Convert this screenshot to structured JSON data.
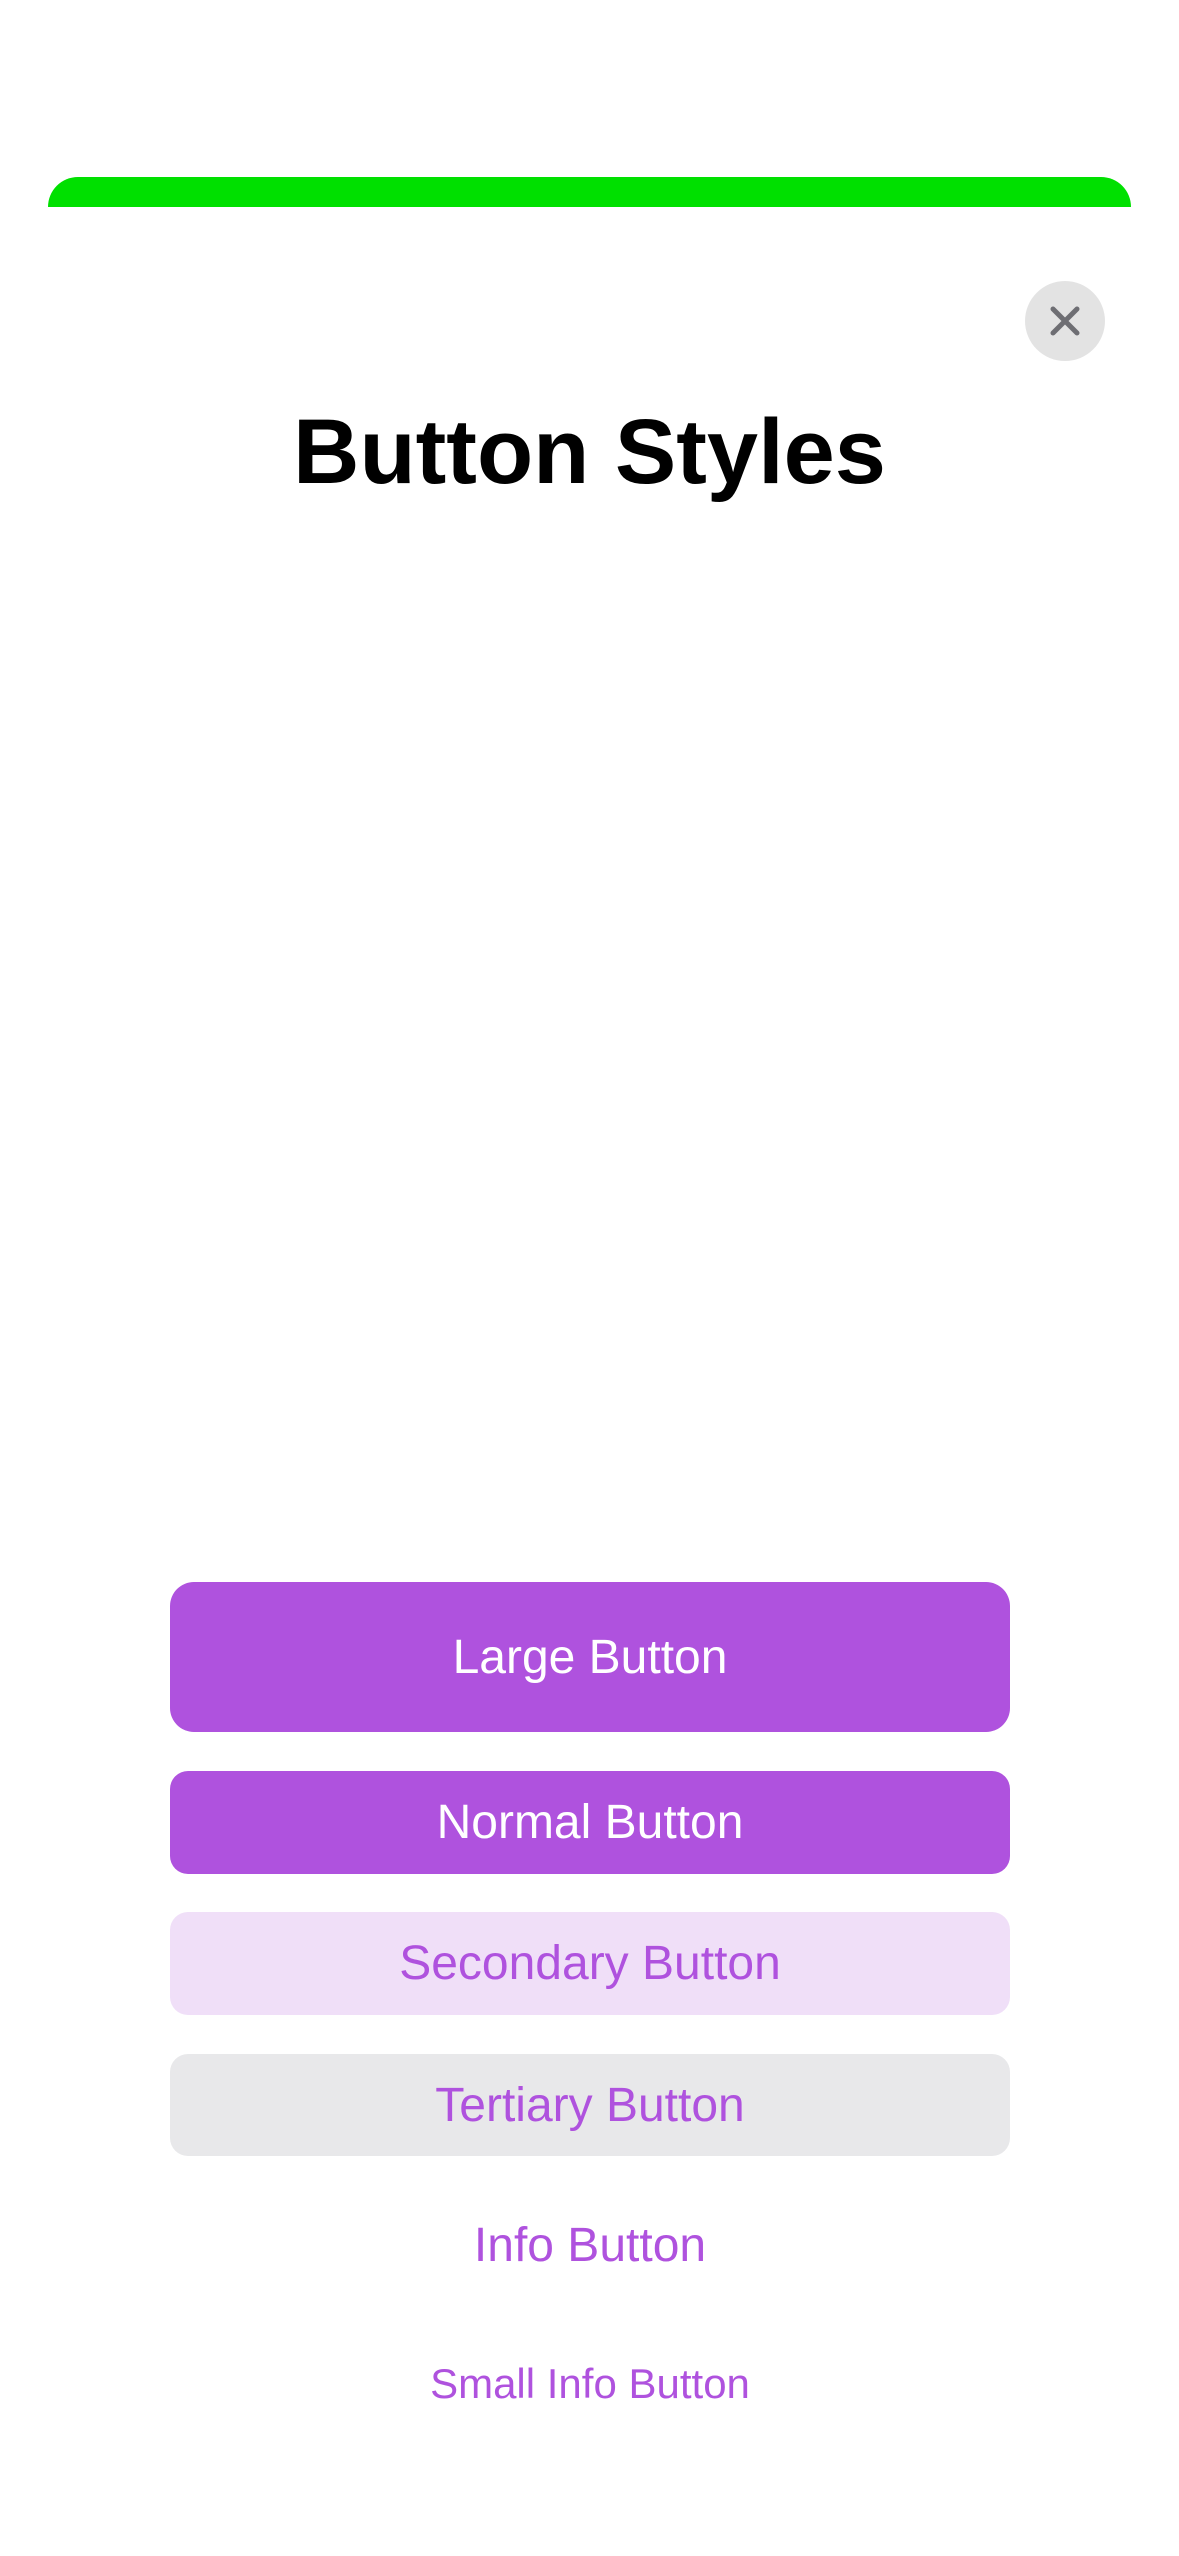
{
  "colors": {
    "top_bar": "#00e000",
    "accent": "#af52de",
    "secondary_bg": "#f0dff8",
    "tertiary_bg": "#e8e8ea",
    "close_bg": "#e3e3e3",
    "close_icon": "#6e6e73"
  },
  "header": {
    "title": "Button Styles",
    "close_icon": "close-icon"
  },
  "buttons": {
    "large": "Large Button",
    "normal": "Normal Button",
    "secondary": "Secondary Button",
    "tertiary": "Tertiary Button",
    "info": "Info Button",
    "small_info": "Small Info Button"
  }
}
